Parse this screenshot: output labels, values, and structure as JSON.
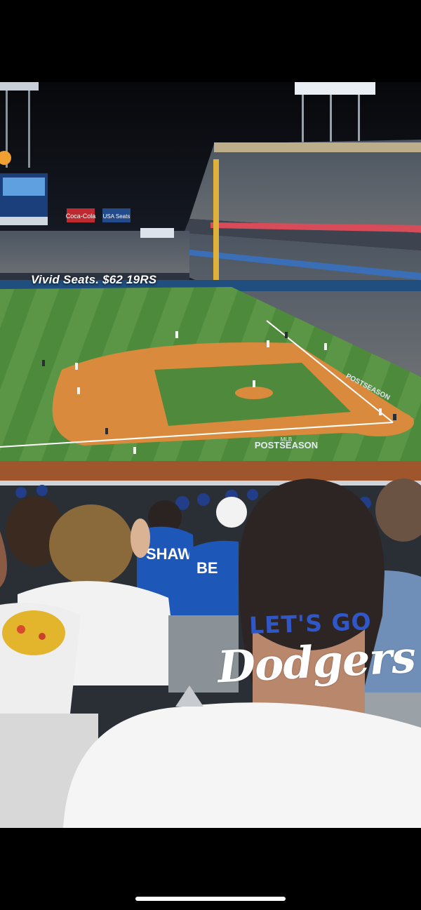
{
  "story": {
    "caption": "Vivid Seats. $62 19RS",
    "sticker": {
      "line1": "LET'S GO",
      "line2": "Dodgers"
    }
  },
  "stadium": {
    "ad_left": "Coca-Cola",
    "ad_right": "USA Seats",
    "field_logo": "POSTSEASON",
    "field_logo_top": "MLB",
    "foul_text": "POSTSEASON",
    "jersey_left": "SHAW",
    "jersey_right": "BE"
  },
  "colors": {
    "grass": "#4f8a3c",
    "dirt": "#d98a3c",
    "dodger_blue": "#2f57c8",
    "sky": "#0b0d12"
  }
}
